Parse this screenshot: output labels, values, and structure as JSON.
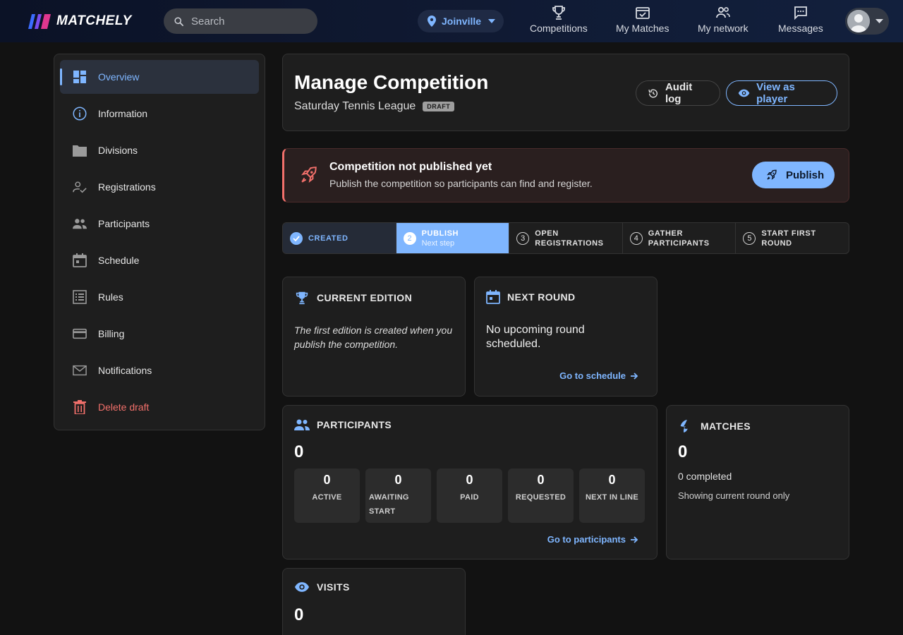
{
  "app": {
    "name": "MATCHELY"
  },
  "topbar": {
    "search_placeholder": "Search",
    "location": "Joinville",
    "nav": [
      {
        "label": "Competitions",
        "icon": "trophy-icon"
      },
      {
        "label": "My Matches",
        "icon": "calendar-check-icon"
      },
      {
        "label": "My network",
        "icon": "people-icon"
      },
      {
        "label": "Messages",
        "icon": "chat-icon"
      }
    ]
  },
  "sidebar": {
    "items": [
      {
        "label": "Overview",
        "icon": "dashboard-icon",
        "active": true
      },
      {
        "label": "Information",
        "icon": "info-icon"
      },
      {
        "label": "Divisions",
        "icon": "folder-icon"
      },
      {
        "label": "Registrations",
        "icon": "person-check-icon"
      },
      {
        "label": "Participants",
        "icon": "people-icon"
      },
      {
        "label": "Schedule",
        "icon": "calendar-icon"
      },
      {
        "label": "Rules",
        "icon": "list-icon"
      },
      {
        "label": "Billing",
        "icon": "credit-card-icon"
      },
      {
        "label": "Notifications",
        "icon": "mail-icon"
      },
      {
        "label": "Delete draft",
        "icon": "trash-icon",
        "danger": true
      }
    ]
  },
  "header": {
    "title": "Manage Competition",
    "subtitle": "Saturday Tennis League",
    "badge": "DRAFT",
    "audit_label": "Audit log",
    "view_label": "View as player"
  },
  "alert": {
    "title": "Competition not published yet",
    "text": "Publish the competition so participants can find and register.",
    "button": "Publish"
  },
  "steps": [
    {
      "num": "",
      "label": "CREATED",
      "state": "done"
    },
    {
      "num": "2",
      "label": "PUBLISH",
      "hint": "Next step",
      "state": "current"
    },
    {
      "num": "3",
      "label": "OPEN REGISTRATIONS",
      "state": "todo"
    },
    {
      "num": "4",
      "label": "GATHER PARTICIPANTS",
      "state": "todo"
    },
    {
      "num": "5",
      "label": "START FIRST ROUND",
      "state": "todo"
    }
  ],
  "edition": {
    "title": "CURRENT EDITION",
    "text": "The first edition is created when you publish the competition."
  },
  "next_round": {
    "title": "NEXT ROUND",
    "text": "No upcoming round scheduled.",
    "link": "Go to schedule"
  },
  "participants": {
    "title": "PARTICIPANTS",
    "total": "0",
    "stats": [
      {
        "value": "0",
        "label": "ACTIVE"
      },
      {
        "value": "0",
        "label": "AWAITING START"
      },
      {
        "value": "0",
        "label": "PAID"
      },
      {
        "value": "0",
        "label": "REQUESTED"
      },
      {
        "value": "0",
        "label": "NEXT IN LINE"
      }
    ],
    "link": "Go to participants"
  },
  "matches": {
    "title": "MATCHES",
    "total": "0",
    "completed": "0 completed",
    "note": "Showing current round only"
  },
  "visits": {
    "title": "VISITS",
    "total": "0"
  },
  "colors": {
    "accent": "#7fb6ff",
    "danger": "#f2706b",
    "card": "#1e1e1e",
    "bg": "#121212"
  }
}
